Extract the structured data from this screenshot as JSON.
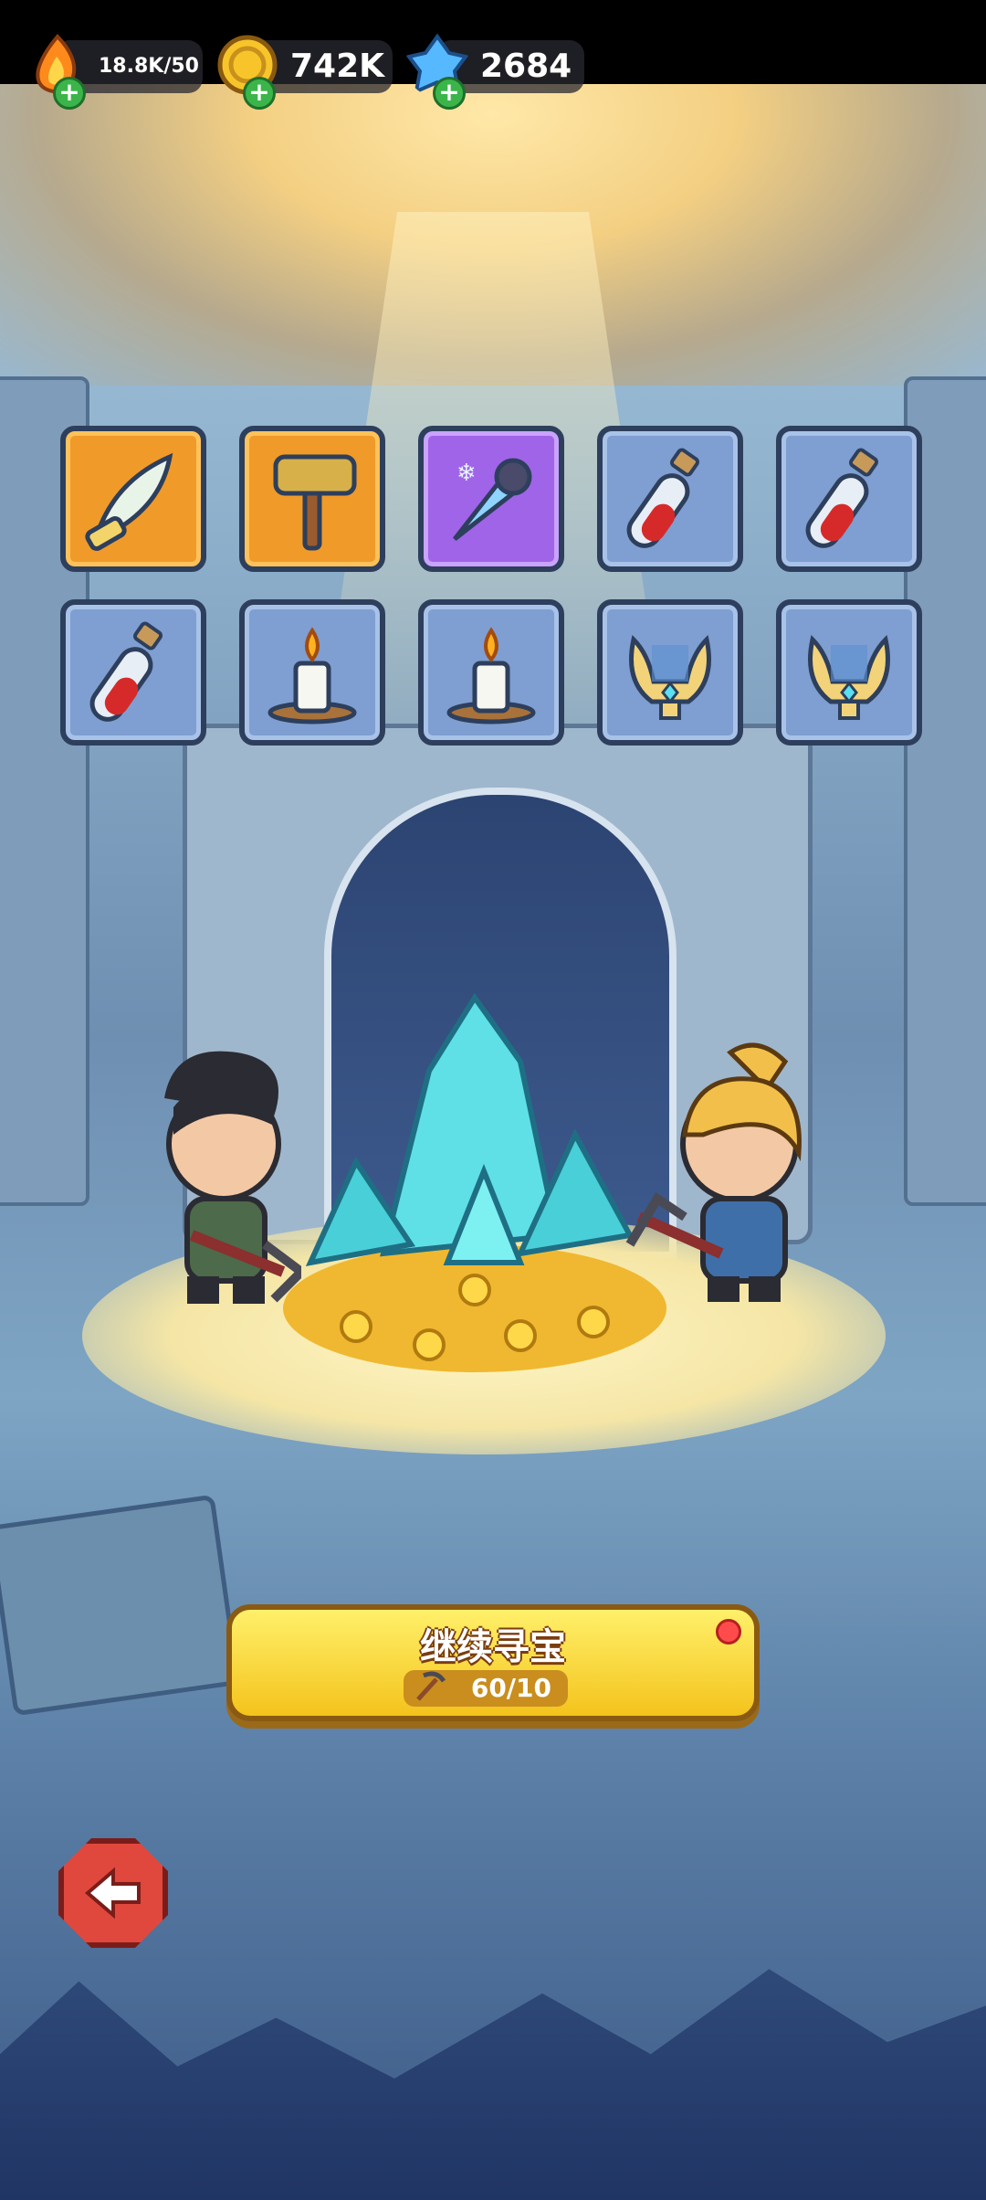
{
  "hud": {
    "energy": "18.8K/50",
    "coins": "742K",
    "gems": "2684"
  },
  "rewards": {
    "row1": [
      "feather-quill",
      "hammer",
      "frost-dagger",
      "red-potion",
      "red-potion"
    ],
    "row2": [
      "red-potion",
      "candle",
      "candle",
      "golden-lyre",
      "golden-lyre"
    ]
  },
  "continue_button": {
    "label": "继续寻宝",
    "count": "60/10"
  },
  "colors": {
    "accent_gold": "#f4c31c",
    "back_red": "#e0483d"
  }
}
